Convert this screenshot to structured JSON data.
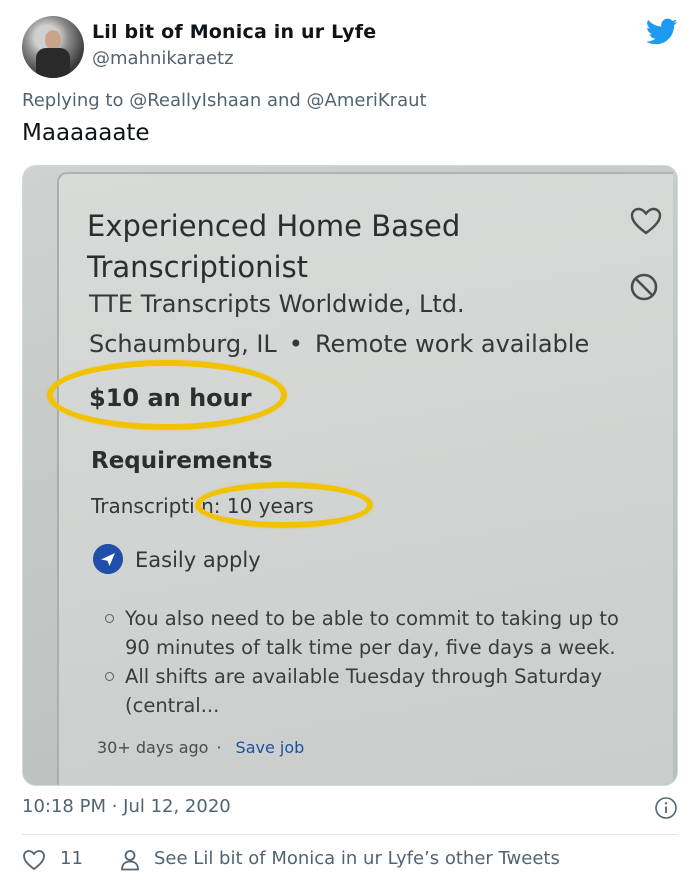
{
  "author": {
    "name": "Lil bit of Monica in ur Lyfe",
    "handle": "@mahnikaraetz",
    "avatar_icon": "profile-photo"
  },
  "reply": {
    "prefix": "Replying to ",
    "mention1": "@ReallyIshaan",
    "joiner": " and ",
    "mention2": "@AmeriKraut"
  },
  "tweet": {
    "text": "Maaaaaate"
  },
  "job_photo": {
    "title": "Experienced Home Based Transcriptionist",
    "company": "TTE Transcripts Worldwide, Ltd.",
    "location": "Schaumburg, IL",
    "location_sep": "•",
    "remote": "Remote work available",
    "pay": "$10 an hour",
    "requirements_heading": "Requirements",
    "requirement": "Transcripti n: 10 years",
    "apply_label": "Easily apply",
    "bullets": [
      "You also need to be able to commit to taking up to 90 minutes of talk time per day, five days a week.",
      "All shifts are available Tuesday through Saturday (central..."
    ],
    "posted": "30+ days ago",
    "meta_sep": "·",
    "save_label": "Save job",
    "highlight_color": "#f2c200"
  },
  "footer": {
    "timestamp": "10:18 PM · Jul 12, 2020",
    "likes": "11",
    "other_tweets": "See Lil bit of Monica in ur Lyfe’s other Tweets"
  },
  "colors": {
    "twitter_blue": "#1d9bf0",
    "secondary_text": "#536471",
    "apply_blue": "#1f4fa8"
  }
}
